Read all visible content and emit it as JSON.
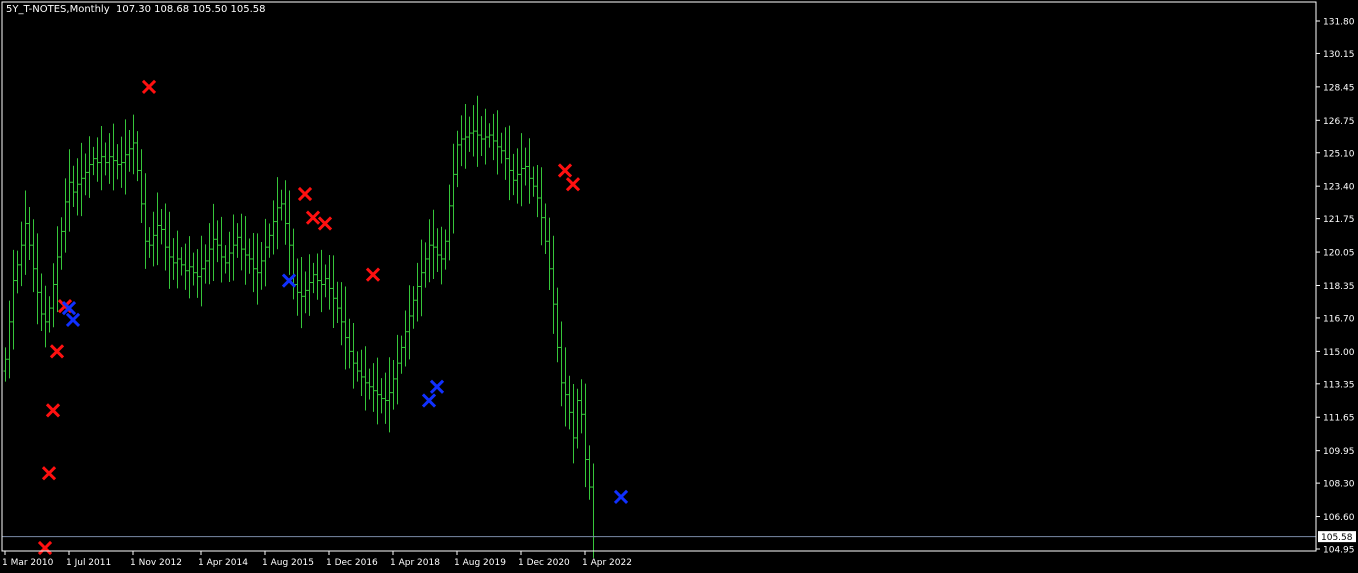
{
  "header": {
    "symbol_period": "5Y_T-NOTES,Monthly",
    "ohlc": "107.30 108.68 105.50 105.58"
  },
  "colors": {
    "background": "#000000",
    "frame": "#ffffff",
    "bars": "#36c63a",
    "up_mark": "#ff1010",
    "down_mark": "#1030ff",
    "price_line": "#7c8ca8",
    "text": "#ffffff"
  },
  "chart_data": {
    "type": "ohlc",
    "symbol": "5Y_T-NOTES",
    "timeframe": "Monthly",
    "last_price_label": "105.58",
    "y_ticks": [
      "131.80",
      "130.15",
      "128.45",
      "126.75",
      "125.10",
      "123.40",
      "121.75",
      "120.05",
      "118.35",
      "116.70",
      "115.00",
      "113.35",
      "111.65",
      "109.95",
      "108.30",
      "106.60",
      "104.95"
    ],
    "x_ticks": [
      {
        "label": "1 Mar 2010",
        "index": 0
      },
      {
        "label": "1 Jul 2011",
        "index": 16
      },
      {
        "label": "1 Nov 2012",
        "index": 32
      },
      {
        "label": "1 Apr 2014",
        "index": 49
      },
      {
        "label": "1 Aug 2015",
        "index": 65
      },
      {
        "label": "1 Dec 2016",
        "index": 81
      },
      {
        "label": "1 Apr 2018",
        "index": 97
      },
      {
        "label": "1 Aug 2019",
        "index": 113
      },
      {
        "label": "1 Dec 2020",
        "index": 129
      },
      {
        "label": "1 Apr 2022",
        "index": 145
      }
    ],
    "closes": [
      114.6,
      116.5,
      118.6,
      119.4,
      120.4,
      121.5,
      120.4,
      119.2,
      118.0,
      116.9,
      116.5,
      117.2,
      118.4,
      119.8,
      121.1,
      122.6,
      123.6,
      123.1,
      123.5,
      123.8,
      124.1,
      124.5,
      124.8,
      124.6,
      124.9,
      124.6,
      124.9,
      124.7,
      124.5,
      124.6,
      125.0,
      125.3,
      125.6,
      124.2,
      122.5,
      120.6,
      120.4,
      120.9,
      121.4,
      121.2,
      120.3,
      119.8,
      119.5,
      119.7,
      119.4,
      119.1,
      119.3,
      119.0,
      118.8,
      119.2,
      119.6,
      120.2,
      120.7,
      120.4,
      119.8,
      119.5,
      120.0,
      120.4,
      120.8,
      120.2,
      119.9,
      119.7,
      119.2,
      119.0,
      119.6,
      120.3,
      120.9,
      121.6,
      122.3,
      122.5,
      121.5,
      120.4,
      118.4,
      118.0,
      117.8,
      118.1,
      118.5,
      118.9,
      118.6,
      118.4,
      118.7,
      118.2,
      117.7,
      117.2,
      116.5,
      115.7,
      115.0,
      114.4,
      114.0,
      113.7,
      113.4,
      113.2,
      113.0,
      112.8,
      112.6,
      112.5,
      112.9,
      113.6,
      114.4,
      115.2,
      116.0,
      116.8,
      117.6,
      118.3,
      119.0,
      119.7,
      120.4,
      120.3,
      119.9,
      119.7,
      120.6,
      122.4,
      124.0,
      125.5,
      125.8,
      125.9,
      126.1,
      126.2,
      126.0,
      125.8,
      125.9,
      126.0,
      125.7,
      125.4,
      125.2,
      124.8,
      124.2,
      123.7,
      124.0,
      124.3,
      124.4,
      123.8,
      123.4,
      122.8,
      121.8,
      120.6,
      119.2,
      117.4,
      115.2,
      113.4,
      112.8,
      111.9,
      110.6,
      112.5,
      111.8,
      109.5,
      108.1,
      105.58
    ],
    "up_marks": [
      {
        "index": 10,
        "price": 105.0
      },
      {
        "index": 11,
        "price": 108.8
      },
      {
        "index": 12,
        "price": 112.0
      },
      {
        "index": 13,
        "price": 115.0
      },
      {
        "index": 15,
        "price": 117.3
      },
      {
        "index": 36,
        "price": 128.45
      },
      {
        "index": 75,
        "price": 123.0
      },
      {
        "index": 77,
        "price": 121.8
      },
      {
        "index": 80,
        "price": 121.5
      },
      {
        "index": 92,
        "price": 118.9
      },
      {
        "index": 140,
        "price": 124.2
      },
      {
        "index": 142,
        "price": 123.5
      }
    ],
    "down_marks": [
      {
        "index": 16,
        "price": 117.2
      },
      {
        "index": 17,
        "price": 116.6
      },
      {
        "index": 71,
        "price": 118.6
      },
      {
        "index": 106,
        "price": 112.5
      },
      {
        "index": 108,
        "price": 113.2
      },
      {
        "index": 154,
        "price": 107.6
      }
    ]
  }
}
